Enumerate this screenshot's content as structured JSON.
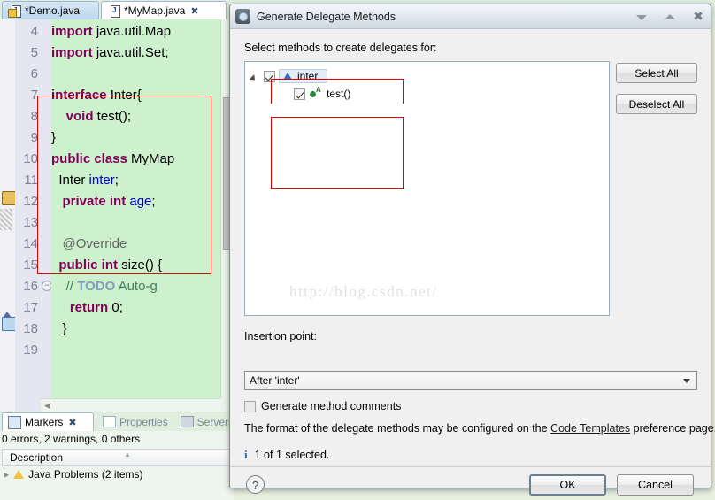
{
  "editor": {
    "tabs": [
      {
        "label": "*Demo.java",
        "icon": "java-file-warning-icon",
        "active": false,
        "closeable": false
      },
      {
        "label": "*MyMap.java",
        "icon": "java-file-icon",
        "active": true,
        "closeable": true,
        "close_glyph": "✖"
      }
    ],
    "lines": [
      {
        "num": "4",
        "html": "<span class='kw'>import</span> java.util.Map"
      },
      {
        "num": "5",
        "html": "<span class='kw'>import</span> java.util.Set;"
      },
      {
        "num": "6",
        "html": ""
      },
      {
        "num": "7",
        "html": "<span class='kw'>interface</span> Inter{"
      },
      {
        "num": "8",
        "html": "    <span class='kw'>void</span> test();"
      },
      {
        "num": "9",
        "html": "}"
      },
      {
        "num": "10",
        "html": "<span class='kw'>public class</span> MyMap"
      },
      {
        "num": "11",
        "html": "  Inter <span class='fld'>inter</span>;"
      },
      {
        "num": "12",
        "html": "   <span class='kw'>private int</span> <span class='fld'>age</span>;"
      },
      {
        "num": "13",
        "html": ""
      },
      {
        "num": "14",
        "html": "   <span class='ann'>@Override</span>"
      },
      {
        "num": "15",
        "html": "  <span class='kw'>public int</span> size() {"
      },
      {
        "num": "16",
        "html": "    <span class='cmt'>// </span><span class='todo'>TODO</span><span class='cmt'> Auto-g</span>"
      },
      {
        "num": "17",
        "html": "     <span class='kw'>return</span> 0;"
      },
      {
        "num": "18",
        "html": "   }"
      },
      {
        "num": "19",
        "html": ""
      }
    ]
  },
  "markers": {
    "tabs": [
      {
        "label": "Markers",
        "icon": "markers-icon",
        "active": true,
        "close_glyph": "✖"
      },
      {
        "label": "Properties",
        "icon": "properties-icon",
        "active": false
      },
      {
        "label": "Servers",
        "icon": "servers-icon",
        "active": false
      }
    ],
    "status": "0 errors, 2 warnings, 0 others",
    "column_header": "Description",
    "rows": [
      {
        "label": "Java Problems (2 items)",
        "icon": "warning-icon"
      }
    ]
  },
  "dialog": {
    "title": "Generate Delegate Methods",
    "title_icon": "gear-icon",
    "window_buttons": [
      {
        "name": "minimize",
        "glyph": "▼"
      },
      {
        "name": "maximize",
        "glyph": "▲"
      },
      {
        "name": "close",
        "glyph": "✖"
      }
    ],
    "prompt": "Select methods to create delegates for:",
    "tree": [
      {
        "label": "inter",
        "icon": "interface-icon",
        "checked": true,
        "selected": true,
        "expanded": true,
        "level": 0
      },
      {
        "label": "test()",
        "icon": "abstract-method-icon",
        "checked": true,
        "selected": false,
        "level": 1
      }
    ],
    "side_buttons": [
      {
        "label": "Select All",
        "name": "select-all-button"
      },
      {
        "label": "Deselect All",
        "name": "deselect-all-button"
      }
    ],
    "watermark": "http://blog.csdn.net/",
    "insertion_point_label": "Insertion point:",
    "insertion_point_value": "After 'inter'",
    "generate_comments_label": "Generate method comments",
    "generate_comments_checked": false,
    "format_note_before": "The format of the delegate methods may be configured on the ",
    "format_note_link": "Code Templates",
    "format_note_after": " preference page.",
    "info_text": "1 of 1 selected.",
    "info_glyph": "i",
    "help_glyph": "?",
    "ok_label": "OK",
    "cancel_label": "Cancel"
  },
  "colors": {
    "editor_bg": "#cdf0cd",
    "keyword": "#7f0055",
    "field": "#0000c0",
    "comment": "#3f7f5f",
    "highlight_box": "#e00000",
    "selection": "#e4eef8"
  }
}
